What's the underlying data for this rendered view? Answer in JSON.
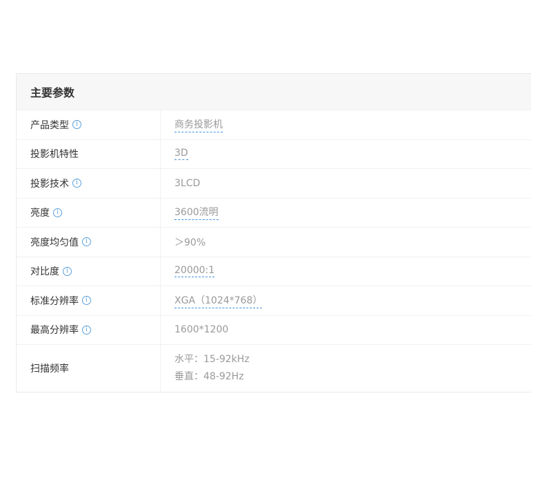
{
  "table": {
    "title": "主要参数",
    "rows": [
      {
        "label": "产品类型",
        "value": "商务投影机"
      },
      {
        "label": "投影机特性",
        "value": "3D"
      },
      {
        "label": "投影技术",
        "value": "3LCD"
      },
      {
        "label": "亮度",
        "value": "3600流明"
      },
      {
        "label": "亮度均匀值",
        "value": "＞90%"
      },
      {
        "label": "对比度",
        "value": "20000:1"
      },
      {
        "label": "标准分辨率",
        "value": "XGA（1024*768）"
      },
      {
        "label": "最高分辨率",
        "value": "1600*1200"
      },
      {
        "label": "扫描频率",
        "values": [
          "水平：15-92kHz",
          "垂直：48-92Hz"
        ]
      }
    ]
  },
  "icons": {
    "info": "info-circle-icon",
    "info_glyph": "i"
  },
  "colors": {
    "link_underline": "#3d8fe0",
    "icon": "#5a9fdc",
    "label_text": "#333333",
    "value_text": "#999999",
    "header_bg": "#f7f7f7"
  }
}
